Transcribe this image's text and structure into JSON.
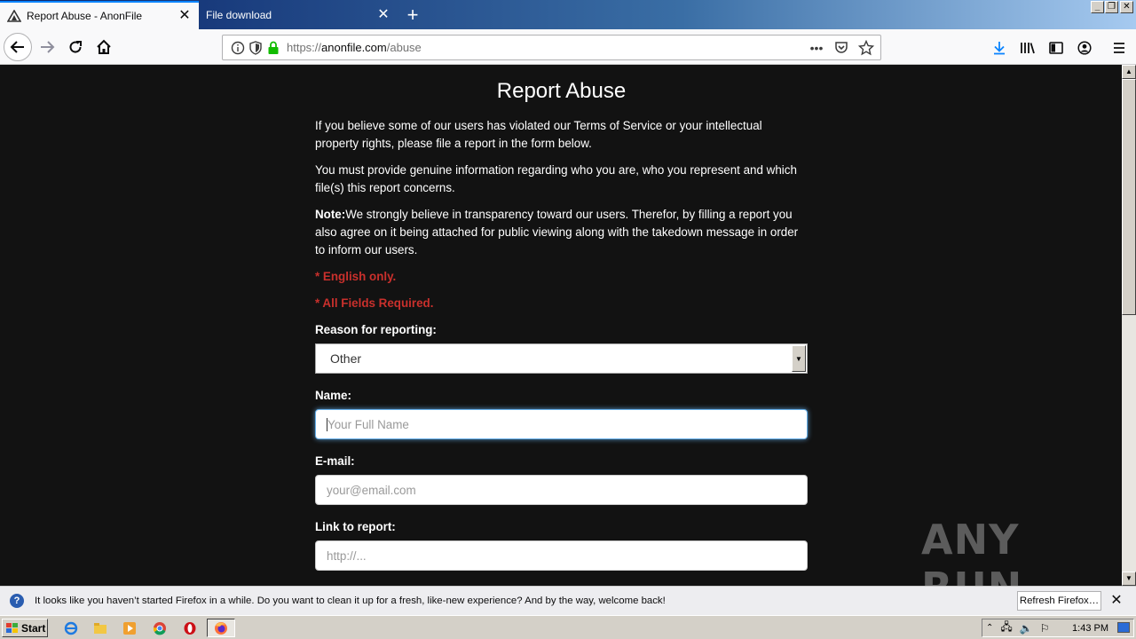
{
  "browser": {
    "tabs": [
      {
        "title": "Report Abuse - AnonFile",
        "active": true
      },
      {
        "title": "File download",
        "active": false
      }
    ],
    "url_prefix": "https://",
    "url_host": "anonfile.com",
    "url_path": "/abuse",
    "notification": {
      "message": "It looks like you haven’t started Firefox in a while. Do you want to clean it up for a fresh, like-new experience? And by the way, welcome back!",
      "button": "Refresh Firefox…"
    }
  },
  "page": {
    "title": "Report Abuse",
    "para1": "If you believe some of our users has violated our Terms of Service or your intellectual property rights, please file a report in the form below.",
    "para2": "You must provide genuine information regarding who you are, who you represent and which file(s) this report concerns.",
    "note_label": "Note:",
    "note_text": "We strongly believe in transparency toward our users. Therefor, by filling a report you also agree on it being attached for public viewing along with the takedown message in order to inform our users.",
    "req1": "* English only.",
    "req2": "* All Fields Required.",
    "form": {
      "reason_label": "Reason for reporting:",
      "reason_value": "Other",
      "name_label": "Name:",
      "name_placeholder": "Your Full Name",
      "email_label": "E-mail:",
      "email_placeholder": "your@email.com",
      "link_label": "Link to report:",
      "link_placeholder": "http://..."
    }
  },
  "watermark": "ANY RUN",
  "taskbar": {
    "start": "Start",
    "clock": "1:43 PM"
  },
  "colors": {
    "page_bg": "#121212",
    "required_text": "#c9302c",
    "focus_ring": "#66afe9",
    "accent": "#0a84ff"
  }
}
